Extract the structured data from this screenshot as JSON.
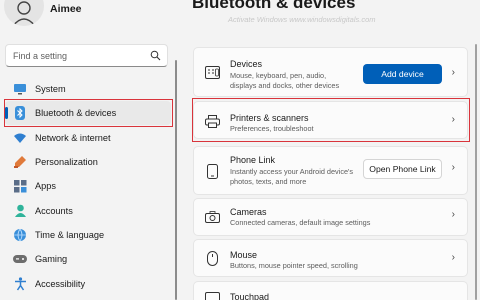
{
  "user": {
    "name": "Aimee"
  },
  "search": {
    "placeholder": "Find a setting"
  },
  "sidebar": {
    "items": [
      {
        "label": "System",
        "icon": "system-icon"
      },
      {
        "label": "Bluetooth & devices",
        "icon": "bluetooth-icon",
        "active": true
      },
      {
        "label": "Network & internet",
        "icon": "wifi-icon"
      },
      {
        "label": "Personalization",
        "icon": "brush-icon"
      },
      {
        "label": "Apps",
        "icon": "apps-icon"
      },
      {
        "label": "Accounts",
        "icon": "person-icon"
      },
      {
        "label": "Time & language",
        "icon": "globe-icon"
      },
      {
        "label": "Gaming",
        "icon": "gamepad-icon"
      },
      {
        "label": "Accessibility",
        "icon": "accessibility-icon"
      }
    ]
  },
  "main": {
    "title": "Bluetooth & devices",
    "watermark": "Activate Windows www.windowsdigitals.com",
    "cards": [
      {
        "title": "Devices",
        "subtitle": "Mouse, keyboard, pen, audio, displays and docks, other devices",
        "button": "Add device"
      },
      {
        "title": "Printers & scanners",
        "subtitle": "Preferences, troubleshoot"
      },
      {
        "title": "Phone Link",
        "subtitle": "Instantly access your Android device's photos, texts, and more",
        "button": "Open Phone Link"
      },
      {
        "title": "Cameras",
        "subtitle": "Connected cameras, default image settings"
      },
      {
        "title": "Mouse",
        "subtitle": "Buttons, mouse pointer speed, scrolling"
      },
      {
        "title": "Touchpad"
      }
    ]
  },
  "colors": {
    "accent": "#005fb8",
    "highlight_frame": "#d9343b"
  }
}
